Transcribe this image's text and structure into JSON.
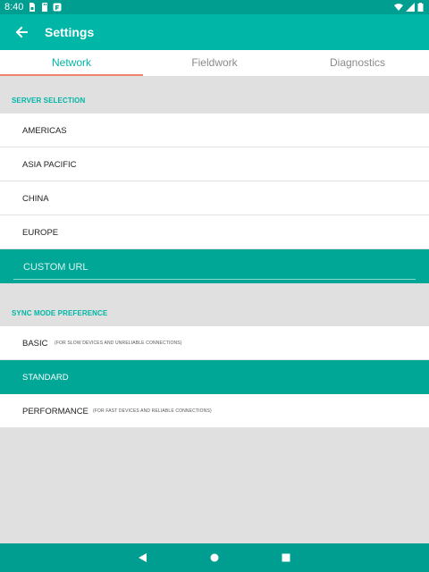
{
  "status_bar": {
    "time": "8:40",
    "left_icons": [
      "sim-card-icon",
      "sd-card-icon",
      "app-notification-icon"
    ],
    "right_icons": [
      "wifi-icon",
      "cell-signal-icon",
      "battery-icon"
    ]
  },
  "app_bar": {
    "title": "Settings",
    "back_icon": "arrow-left-icon"
  },
  "tabs": [
    {
      "label": "Network",
      "active": true
    },
    {
      "label": "Fieldwork",
      "active": false
    },
    {
      "label": "Diagnostics",
      "active": false
    }
  ],
  "server_selection": {
    "header": "SERVER SELECTION",
    "options": [
      {
        "label": "AMERICAS"
      },
      {
        "label": "ASIA PACIFIC"
      },
      {
        "label": "CHINA"
      },
      {
        "label": "EUROPE"
      }
    ],
    "custom_url": {
      "placeholder": "CUSTOM URL",
      "value": ""
    }
  },
  "sync_mode": {
    "header": "SYNC MODE PREFERENCE",
    "options": [
      {
        "label": "BASIC",
        "note": "(FOR SLOW DEVICES AND UNRELIABLE CONNECTIONS)",
        "selected": false
      },
      {
        "label": "STANDARD",
        "note": "",
        "selected": true
      },
      {
        "label": "PERFORMANCE",
        "note": "(FOR FAST DEVICES AND RELIABLE CONNECTIONS)",
        "selected": false
      }
    ]
  },
  "nav_bar": {
    "icons": [
      "back-triangle-icon",
      "home-circle-icon",
      "recents-square-icon"
    ]
  },
  "colors": {
    "primary": "#00b6a6",
    "primary_dark": "#009e91",
    "selected_row": "#00a797",
    "tab_indicator": "#f0836e",
    "background": "#e0e0e0"
  }
}
